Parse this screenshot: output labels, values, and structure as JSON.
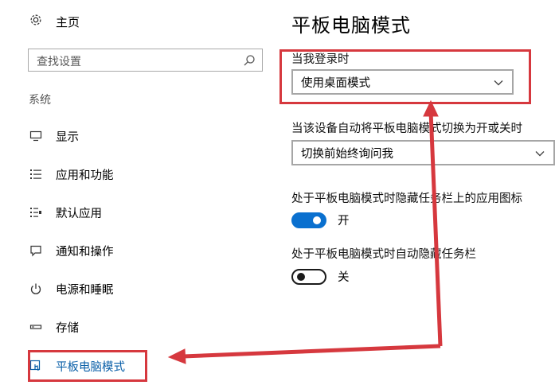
{
  "sidebar": {
    "home_label": "主页",
    "search_placeholder": "查找设置",
    "section_label": "系统",
    "items": [
      {
        "label": "显示",
        "icon": "monitor-icon"
      },
      {
        "label": "应用和功能",
        "icon": "list-icon"
      },
      {
        "label": "默认应用",
        "icon": "default-apps-icon"
      },
      {
        "label": "通知和操作",
        "icon": "message-icon"
      },
      {
        "label": "电源和睡眠",
        "icon": "power-icon"
      },
      {
        "label": "存储",
        "icon": "storage-icon"
      },
      {
        "label": "平板电脑模式",
        "icon": "tablet-mode-icon",
        "active": true
      }
    ]
  },
  "main": {
    "title": "平板电脑模式",
    "signin_label": "当我登录时",
    "signin_value": "使用桌面模式",
    "auto_switch_label": "当该设备自动将平板电脑模式切换为开或关时",
    "auto_switch_value": "切换前始终询问我",
    "hide_icons_label": "处于平板电脑模式时隐藏任务栏上的应用图标",
    "hide_icons_state": "开",
    "auto_hide_label": "处于平板电脑模式时自动隐藏任务栏",
    "auto_hide_state": "关"
  },
  "colors": {
    "accent": "#0a70cf",
    "active_nav": "#0a5fa8",
    "annotation_red": "#d6383e"
  }
}
